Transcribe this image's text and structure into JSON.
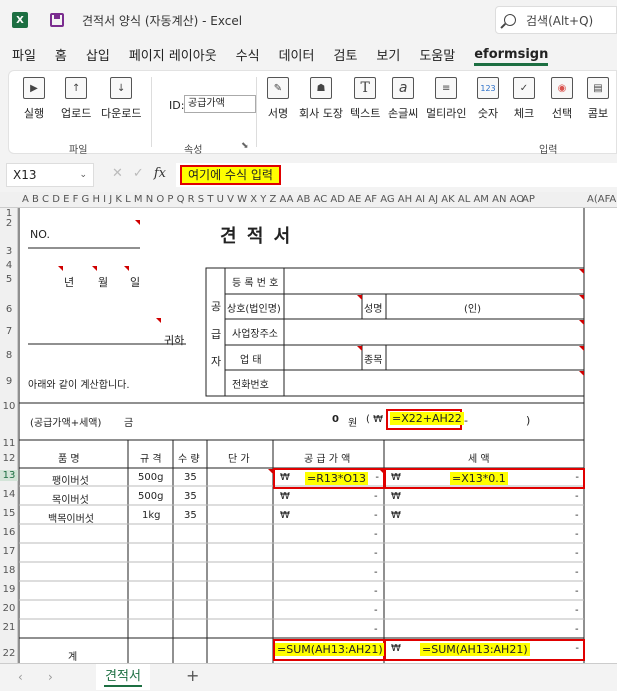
{
  "window": {
    "title": "견적서 양식 (자동계산)  -  Excel",
    "search": "검색(Alt+Q)"
  },
  "menu": [
    "파일",
    "홈",
    "삽입",
    "페이지 레이아웃",
    "수식",
    "데이터",
    "검토",
    "보기",
    "도움말",
    "eformsign"
  ],
  "ribbon": {
    "file_group": [
      "실행",
      "업로드",
      "다운로드"
    ],
    "file_label": "파일",
    "id_label": "ID:",
    "id_value": "공급가액",
    "attr_label": "속성",
    "input_group": [
      "서명",
      "회사 도장",
      "텍스트",
      "손글씨",
      "멀티라인",
      "숫자",
      "체크",
      "선택",
      "콤보"
    ],
    "number_icon": "123",
    "input_label": "입력"
  },
  "formula_bar": {
    "cell_ref": "X13",
    "formula": "여기에 수식 입력"
  },
  "columns": "A B C D E F G H I  J  K L M N O P Q R S T U V W X Y Z AA AB AC AD AE AF AG AH AI AJ AK AL AM AN AO",
  "columns_tail": "AP",
  "columns_far": "A(AFA)",
  "rows": [
    "1",
    "2",
    "3",
    "4",
    "5",
    "6",
    "7",
    "8",
    "9",
    "10",
    "11",
    "12",
    "13",
    "14",
    "15",
    "16",
    "17",
    "18",
    "19",
    "20",
    "21",
    "22"
  ],
  "sheet": {
    "no": "NO.",
    "title": "견 적 서",
    "date_year": "년",
    "date_month": "월",
    "date_day": "일",
    "recipient": "귀하",
    "note": "아래와 같이 계산합니다.",
    "supplier_side": [
      "공",
      "급",
      "자"
    ],
    "supplier_fields": [
      "등 록 번 호",
      "상호(법인명)",
      "사업장주소",
      "업  태",
      "전화번호"
    ],
    "name_label": "성명",
    "seal": "(인)",
    "category_label": "종목",
    "total_label": "(공급가액+세액)",
    "amount_word": "금",
    "zero": "0",
    "won": "원",
    "paren_open": "( ₩",
    "paren_close": ")",
    "total_formula": "=X22+AH22",
    "headers": [
      "품  명",
      "규 격",
      "수 량",
      "단 가",
      "공 급 가 액",
      "세  액"
    ],
    "items": [
      {
        "name": "팽이버섯",
        "spec": "500g",
        "qty": "35"
      },
      {
        "name": "목이버섯",
        "spec": "500g",
        "qty": "35"
      },
      {
        "name": "백목이버섯",
        "spec": "1kg",
        "qty": "35"
      }
    ],
    "won_sign": "₩",
    "dash": "-",
    "supply_formula": "=R13*O13",
    "tax_formula": "=X13*0.1",
    "sum_label": "계",
    "sum_supply": "=SUM(AH13:AH21)",
    "sum_tax": "=SUM(AH13:AH21)"
  },
  "tabs": {
    "sheet": "견적서",
    "add": "+"
  }
}
